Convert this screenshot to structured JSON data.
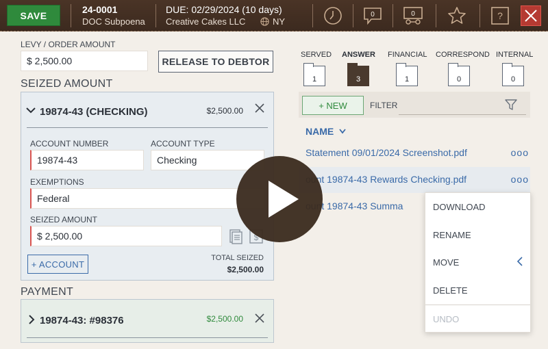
{
  "header": {
    "save_label": "SAVE",
    "case_prefix": "24",
    "case_suffix": "-0001",
    "case_type": "DOC Subpoena",
    "due": "DUE: 02/29/2024 (10 days)",
    "company": "Creative Cakes LLC",
    "state": "NY",
    "notes_count": "0",
    "contacts_count": "0"
  },
  "levy": {
    "label": "LEVY / ORDER AMOUNT",
    "value": "$ 2,500.00",
    "release_button": "RELEASE TO DEBTOR"
  },
  "seized_section": {
    "title": "SEIZED AMOUNT",
    "card_title": "19874-43 (CHECKING)",
    "card_amount": "$2,500.00",
    "account_number_label": "ACCOUNT NUMBER",
    "account_number": "19874-43",
    "account_type_label": "ACCOUNT TYPE",
    "account_type": "Checking",
    "exemptions_label": "EXEMPTIONS",
    "exemptions": "Federal",
    "seized_label": "SEIZED AMOUNT",
    "seized_value": "$ 2,500.00",
    "add_account": "+ ACCOUNT",
    "total_label": "TOTAL SEIZED",
    "total_value": "$2,500.00"
  },
  "payment_section": {
    "title": "PAYMENT",
    "card_title": "19874-43: #98376",
    "card_amount": "$2,500.00"
  },
  "tabs": [
    {
      "label": "SERVED",
      "count": "1"
    },
    {
      "label": "ANSWER",
      "count": "3"
    },
    {
      "label": "FINANCIAL",
      "count": "1"
    },
    {
      "label": "CORRESPOND",
      "count": "0"
    },
    {
      "label": "INTERNAL",
      "count": "0"
    }
  ],
  "files": {
    "new_button": "+ NEW",
    "filter_label": "FILTER",
    "name_header": "NAME",
    "rows": [
      "Statement 09/01/2024 Screenshot.pdf",
      "ount 19874-43 Rewards Checking.pdf",
      "ount 19874-43 Summa"
    ],
    "row_menu": "ooo"
  },
  "context_menu": [
    "DOWNLOAD",
    "RENAME",
    "MOVE",
    "DELETE",
    "UNDO"
  ],
  "colors": {
    "header_bg": "#3c2a1f",
    "save_green": "#2f8a3c",
    "link_blue": "#3a6aa8",
    "required_red": "#d9534f"
  }
}
